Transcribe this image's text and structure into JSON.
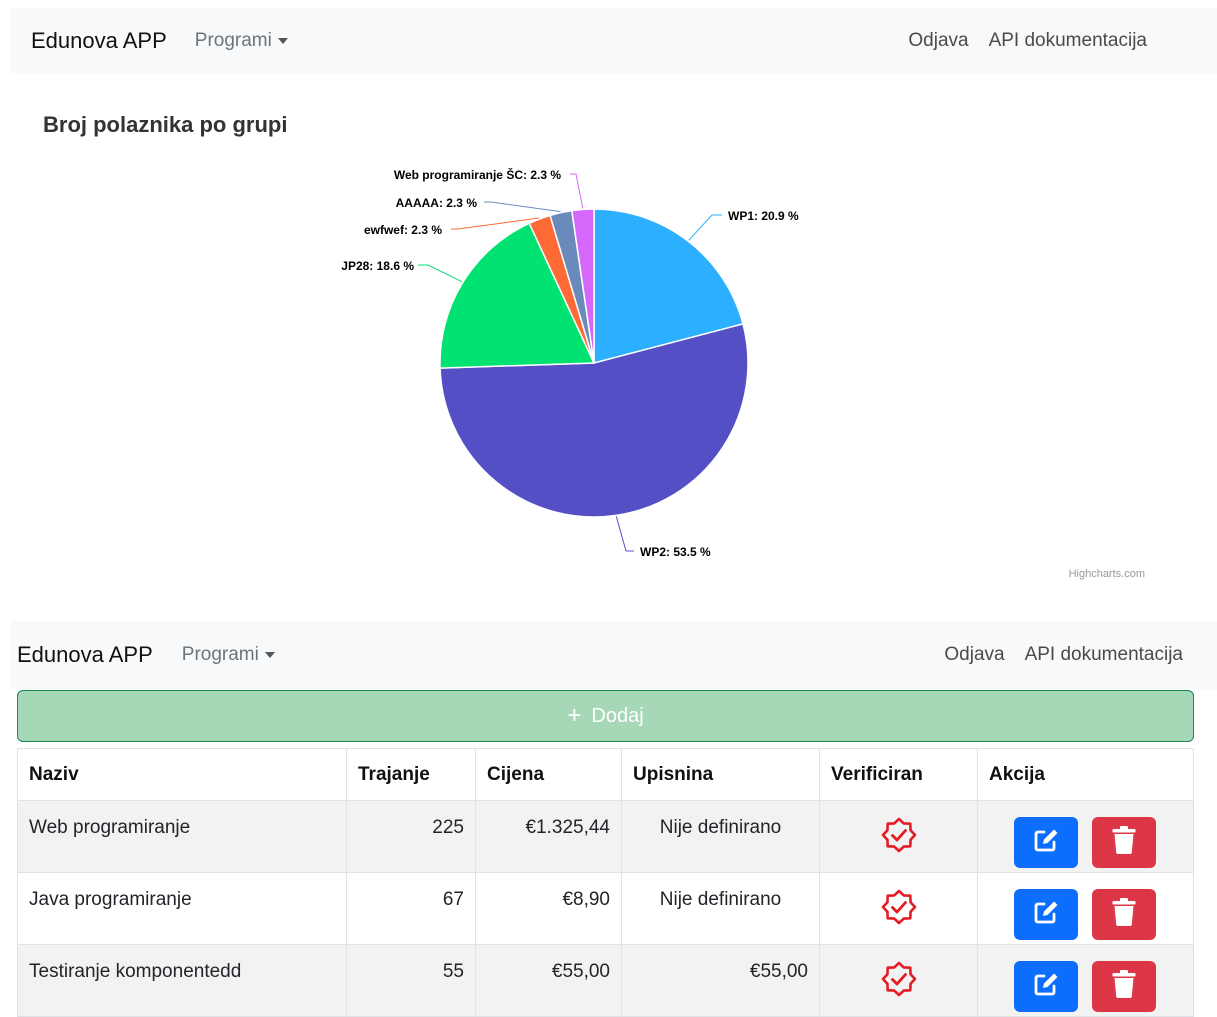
{
  "navbar_top": {
    "brand": "Edunova APP",
    "programs_menu": "Programi",
    "logout": "Odjava",
    "api_docs": "API dokumentacija"
  },
  "navbar_bottom": {
    "brand": "Edunova APP",
    "programs_menu": "Programi",
    "logout": "Odjava",
    "api_docs": "API dokumentacija"
  },
  "chart_data": {
    "type": "pie",
    "title": "Broj polaznika po grupi",
    "credits": "Highcharts.com",
    "slices": [
      {
        "name": "WP1",
        "value": 20.9,
        "label": "WP1: 20.9 %",
        "color": "#2caffe"
      },
      {
        "name": "WP2",
        "value": 53.5,
        "label": "WP2: 53.5 %",
        "color": "#544fc5"
      },
      {
        "name": "JP28",
        "value": 18.6,
        "label": "JP28: 18.6 %",
        "color": "#00e272"
      },
      {
        "name": "ewfwef",
        "value": 2.3,
        "label": "ewfwef: 2.3 %",
        "color": "#fe6a35"
      },
      {
        "name": "AAAAA",
        "value": 2.3,
        "label": "AAAAA: 2.3 %",
        "color": "#6b8abc"
      },
      {
        "name": "Web programiranje ŠC",
        "value": 2.3,
        "label": "Web programiranje ŠC: 2.3 %",
        "color": "#d568fb"
      }
    ]
  },
  "add_button": {
    "label": "Dodaj"
  },
  "table": {
    "headers": {
      "naziv": "Naziv",
      "trajanje": "Trajanje",
      "cijena": "Cijena",
      "upisnina": "Upisnina",
      "verificiran": "Verificiran",
      "akcija": "Akcija"
    },
    "rows": [
      {
        "naziv": "Web programiranje",
        "trajanje": "225",
        "cijena": "€1.325,44",
        "upisnina": "Nije definirano",
        "verificiran": "badge-check-icon"
      },
      {
        "naziv": "Java programiranje",
        "trajanje": "67",
        "cijena": "€8,90",
        "upisnina": "Nije definirano",
        "verificiran": "badge-check-icon"
      },
      {
        "naziv": "Testiranje komponentedd",
        "trajanje": "55",
        "cijena": "€55,00",
        "upisnina": "€55,00",
        "verificiran": "badge-check-icon"
      }
    ]
  },
  "colors": {
    "navbar_bg": "#f8f9fa",
    "success_light": "#a6d8b7",
    "primary": "#0d6efd",
    "danger": "#dc3545",
    "verified_icon": "#e41b23"
  }
}
